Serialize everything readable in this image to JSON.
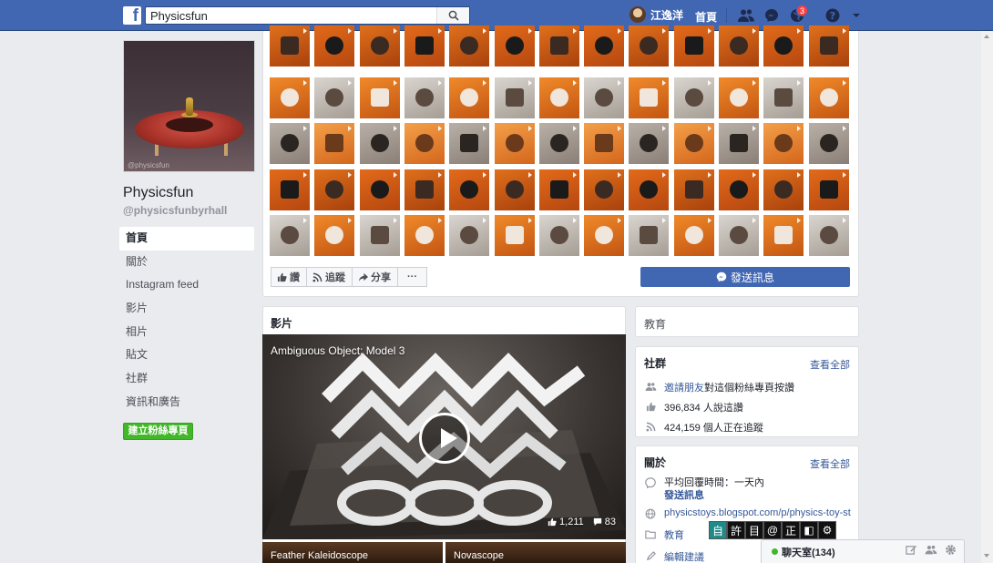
{
  "topbar": {
    "search_value": "Physicsfun",
    "user_name": "江逸洋",
    "home_label": "首頁",
    "notification_count": "3"
  },
  "profile": {
    "page_name": "Physicsfun",
    "handle": "@physicsfunbyrhall",
    "photo_caption": "@physicsfun"
  },
  "left_nav": {
    "items": [
      "首頁",
      "關於",
      "Instagram feed",
      "影片",
      "相片",
      "貼文",
      "社群",
      "資訊和廣告"
    ],
    "create_page_label": "建立粉絲專頁"
  },
  "cover": {
    "actions": {
      "like": "讚",
      "follow": "追蹤",
      "share": "分享",
      "more": "···"
    },
    "send_message_label": "發送訊息"
  },
  "videos": {
    "title": "影片",
    "main_title": "Ambiguous Object: Model 3",
    "likes": "1,211",
    "comments": "83",
    "small": [
      "Feather Kaleidoscope",
      "Novascope"
    ]
  },
  "category_card": {
    "text": "教育"
  },
  "community": {
    "title": "社群",
    "see_all": "查看全部",
    "invite_link": "邀請朋友",
    "invite_rest": " 對這個粉絲專頁按讚",
    "likes_text": "396,834 人說這讚",
    "follows_text": "424,159 個人正在追蹤"
  },
  "about": {
    "title": "關於",
    "see_all": "查看全部",
    "response_time": "平均回覆時間：一天內",
    "send_message": "發送訊息",
    "website": "physicstoys.blogspot.com/p/physics-toy-store",
    "category": "教育",
    "suggest_edits": "編輯建議"
  },
  "ime_bar": [
    "自",
    "許",
    "目",
    "@",
    "正",
    "◧",
    "⚙"
  ],
  "chat": {
    "label": "聊天室(134)"
  },
  "colors": {
    "brand_blue": "#4267b2",
    "link_blue": "#365899",
    "create_green": "#42b72a",
    "page_bg": "#e9ebee"
  },
  "icons": {
    "search": "magnifier-icon",
    "friends": "friends-icon",
    "messenger": "messenger-icon",
    "notifications": "globe-icon",
    "help": "question-icon"
  }
}
